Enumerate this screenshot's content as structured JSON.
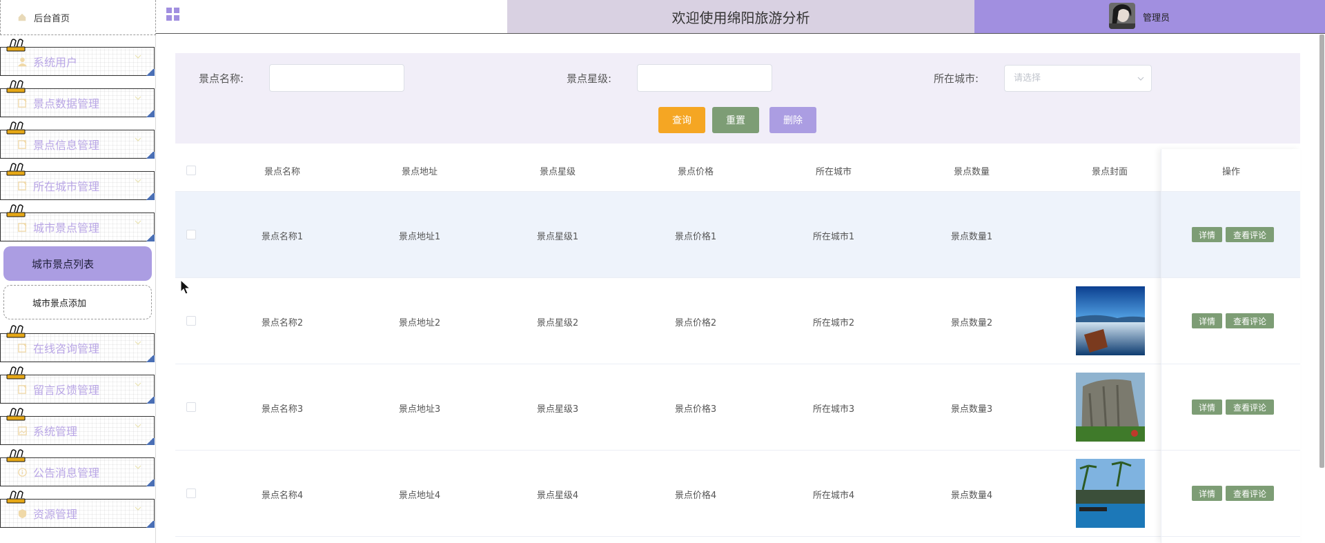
{
  "sidebar": {
    "home": "后台首页",
    "items": [
      {
        "label": "系统用户",
        "icon": "user-icon"
      },
      {
        "label": "景点数据管理",
        "icon": "file-icon"
      },
      {
        "label": "景点信息管理",
        "icon": "file-icon"
      },
      {
        "label": "所在城市管理",
        "icon": "file-icon"
      },
      {
        "label": "城市景点管理",
        "icon": "file-icon"
      },
      {
        "label": "在线咨询管理",
        "icon": "file-icon"
      },
      {
        "label": "留言反馈管理",
        "icon": "file-icon"
      },
      {
        "label": "系统管理",
        "icon": "image-icon"
      },
      {
        "label": "公告消息管理",
        "icon": "info-icon"
      },
      {
        "label": "资源管理",
        "icon": "shield-icon"
      }
    ],
    "sub_active": "城市景点列表",
    "sub_item": "城市景点添加"
  },
  "header": {
    "title": "欢迎使用绵阳旅游分析",
    "username": "管理员"
  },
  "search": {
    "name_label": "景点名称:",
    "star_label": "景点星级:",
    "city_label": "所在城市:",
    "city_placeholder": "请选择",
    "query_btn": "查询",
    "reset_btn": "重置",
    "delete_btn": "删除"
  },
  "table": {
    "headers": [
      "景点名称",
      "景点地址",
      "景点星级",
      "景点价格",
      "所在城市",
      "景点数量",
      "景点封面",
      "操作"
    ],
    "rows": [
      {
        "name": "景点名称1",
        "addr": "景点地址1",
        "star": "景点星级1",
        "price": "景点价格1",
        "city": "所在城市1",
        "count": "景点数量1",
        "cover": "none"
      },
      {
        "name": "景点名称2",
        "addr": "景点地址2",
        "star": "景点星级2",
        "price": "景点价格2",
        "city": "所在城市2",
        "count": "景点数量2",
        "cover": "lake"
      },
      {
        "name": "景点名称3",
        "addr": "景点地址3",
        "star": "景点星级3",
        "price": "景点价格3",
        "city": "所在城市3",
        "count": "景点数量3",
        "cover": "cliff"
      },
      {
        "name": "景点名称4",
        "addr": "景点地址4",
        "star": "景点星级4",
        "price": "景点价格4",
        "city": "所在城市4",
        "count": "景点数量4",
        "cover": "resort"
      }
    ],
    "detail_btn": "详情",
    "review_btn": "查看评论"
  },
  "colors": {
    "accent": "#a18fe0",
    "query": "#f5a623",
    "reset": "#7d9d75",
    "delete": "#ab9de2"
  }
}
